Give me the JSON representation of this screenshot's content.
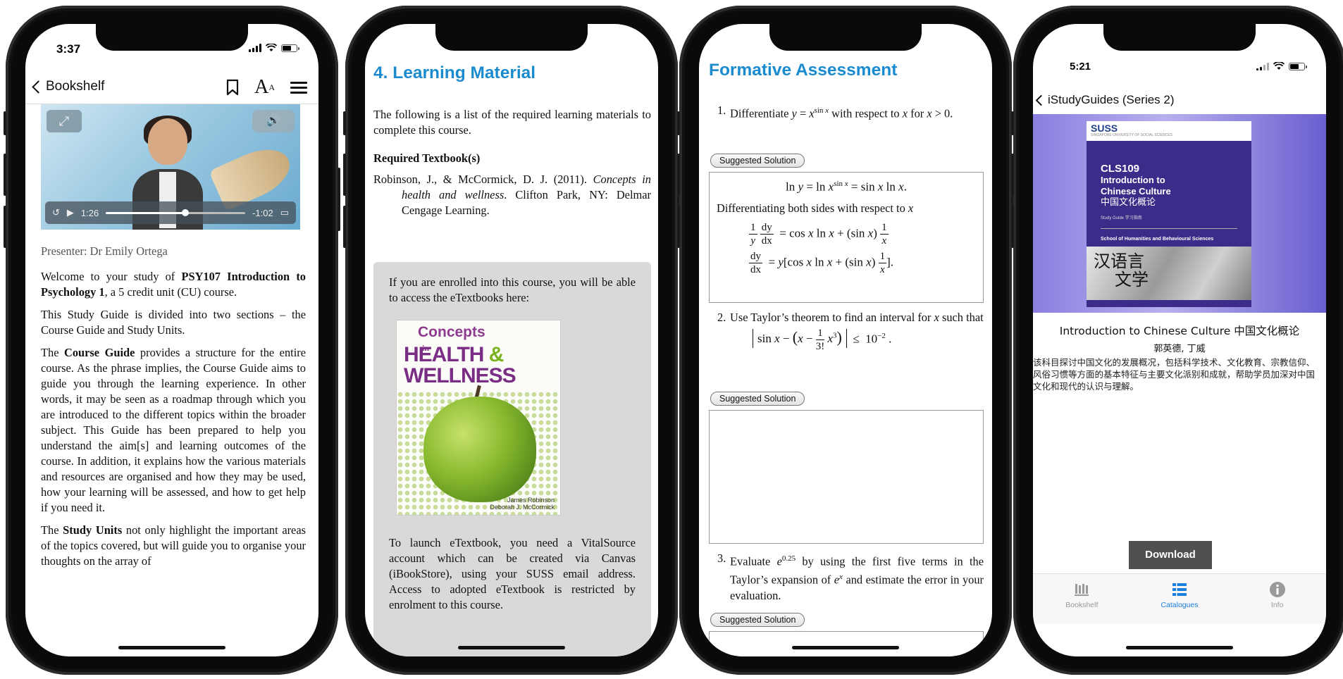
{
  "phone1": {
    "status_time": "3:37",
    "nav": {
      "back_label": "Bookshelf",
      "text_size_label": "A",
      "text_size_small": "A"
    },
    "video": {
      "elapsed": "1:26",
      "remaining": "-1:02",
      "progress": 0.57
    },
    "presenter": "Presenter: Dr Emily Ortega",
    "para1_pre": "Welcome to your study of ",
    "para1_bold": "PSY107 Introduction to Psychology 1",
    "para1_post": ", a 5 credit unit (CU) course.",
    "para2": "This Study Guide is divided into two sections – the Course Guide and Study Units.",
    "para3_pre": "The ",
    "para3_bold": "Course Guide",
    "para3_post": " provides a structure for the entire course. As the phrase implies, the Course Guide aims to guide you through the learning experience. In other words, it may be seen as a roadmap through which you are introduced to the different topics within the broader subject. This Guide has been prepared to help you understand the aim[s] and learning outcomes of the course. In addition, it explains how the various materials and resources are organised and how they may be used, how your learning will be assessed, and how to get help if you need it.",
    "para4_pre": "The ",
    "para4_bold": "Study Units",
    "para4_post": " not only highlight the important areas of the topics covered, but will guide you to organise your thoughts on the array of"
  },
  "phone2": {
    "title": "4. Learning Material",
    "intro": "The following is a list of the required learning materials to complete this course.",
    "required_heading": "Required Textbook(s)",
    "reference_pre": "Robinson, J., & McCormick, D. J. (2011). ",
    "reference_italic": "Concepts in health and wellness",
    "reference_post": ". Clifton Park, NY: Delmar Cengage Learning.",
    "box_text1": "If you are enrolled into this course, you will be able to access the eTextbooks here:",
    "cover": {
      "line1": "Concepts",
      "line2": "in",
      "line3a": "HEALTH ",
      "line3b": "&",
      "line4": "WELLNESS",
      "author1": "James Robinson",
      "author2": "Deborah J. McCormick"
    },
    "box_text2": "To launch eTextbook, you need a VitalSource account which can be created via Canvas (iBookStore), using your SUSS email address. Access to adopted eTextbook is restricted by enrolment to this course."
  },
  "phone3": {
    "title": "Formative Assessment",
    "q1_num": "1.",
    "q1_text_a": "Differentiate ",
    "q1_text_b": " with respect to ",
    "q1_text_c": " for ",
    "solution_label": "Suggested Solution",
    "sol1_line2": "Differentiating both sides with respect to ",
    "q2_num": "2.",
    "q2_text": "Use Taylor’s theorem to find an interval for ",
    "q2_text_b": " such that",
    "q3_num": "3.",
    "q3_text_a": "Evaluate ",
    "q3_text_b": " by using the first five terms in the Taylor’s expansion of ",
    "q3_text_c": " and estimate the error in your evaluation."
  },
  "phone4": {
    "status_time": "5:21",
    "back_label": "iStudyGuides (Series 2)",
    "book": {
      "logo": "SUSS",
      "logo_sub": "SINGAPORE UNIVERSITY OF SOCIAL SCIENCES",
      "code": "CLS109",
      "title_line1": "Introduction to",
      "title_line2": "Chinese Culture",
      "title_cn": "中国文化概论",
      "meta": "Study Guide  学习指南",
      "school": "School of Humanities and Behavioural Sciences",
      "calligraphy1": "汉语言",
      "calligraphy2": "文学"
    },
    "title": "Introduction to Chinese Culture 中国文化概论",
    "authors": "郭英德, 丁威",
    "description": "该科目探讨中国文化的发展概况，包括科学技术、文化教育、宗教信仰、风俗习惯等方面的基本特征与主要文化派别和成就，帮助学员加深对中国文化和现代的认识与理解。",
    "download_label": "Download",
    "tabs": [
      {
        "label": "Bookshelf",
        "icon": "bookshelf-icon",
        "active": false
      },
      {
        "label": "Catalogues",
        "icon": "list-icon",
        "active": true
      },
      {
        "label": "Info",
        "icon": "info-icon",
        "active": false
      }
    ]
  },
  "colors": {
    "accent_blue": "#1b8bcf",
    "tab_active": "#1b7fe0",
    "download_bg": "#505050",
    "banner": "#8a7fe0"
  }
}
